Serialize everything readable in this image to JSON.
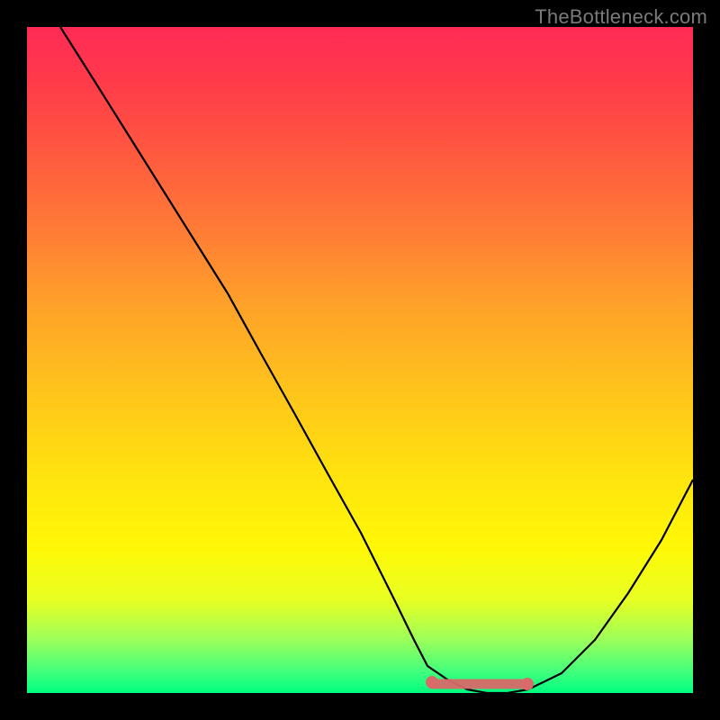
{
  "watermark": "TheBottleneck.com",
  "colors": {
    "background": "#000000",
    "gradient_top": "#ff2a55",
    "gradient_bottom": "#00ff80",
    "curve": "#000000",
    "marker": "#d96a6a"
  },
  "chart_data": {
    "type": "line",
    "title": "",
    "xlabel": "",
    "ylabel": "",
    "xlim": [
      0,
      100
    ],
    "ylim": [
      0,
      100
    ],
    "x": [
      5,
      10,
      15,
      20,
      25,
      30,
      35,
      40,
      45,
      50,
      55,
      58,
      60,
      63,
      66,
      69,
      72,
      75,
      80,
      85,
      90,
      95,
      100
    ],
    "values": [
      100,
      92,
      84,
      76,
      68,
      60,
      51,
      42,
      33,
      24,
      14,
      8,
      4,
      2,
      0.5,
      0,
      0,
      0.5,
      3,
      8,
      15,
      23,
      32
    ],
    "minimum_band": {
      "x_start": 60,
      "x_end": 75,
      "y": 0
    },
    "annotations": []
  }
}
